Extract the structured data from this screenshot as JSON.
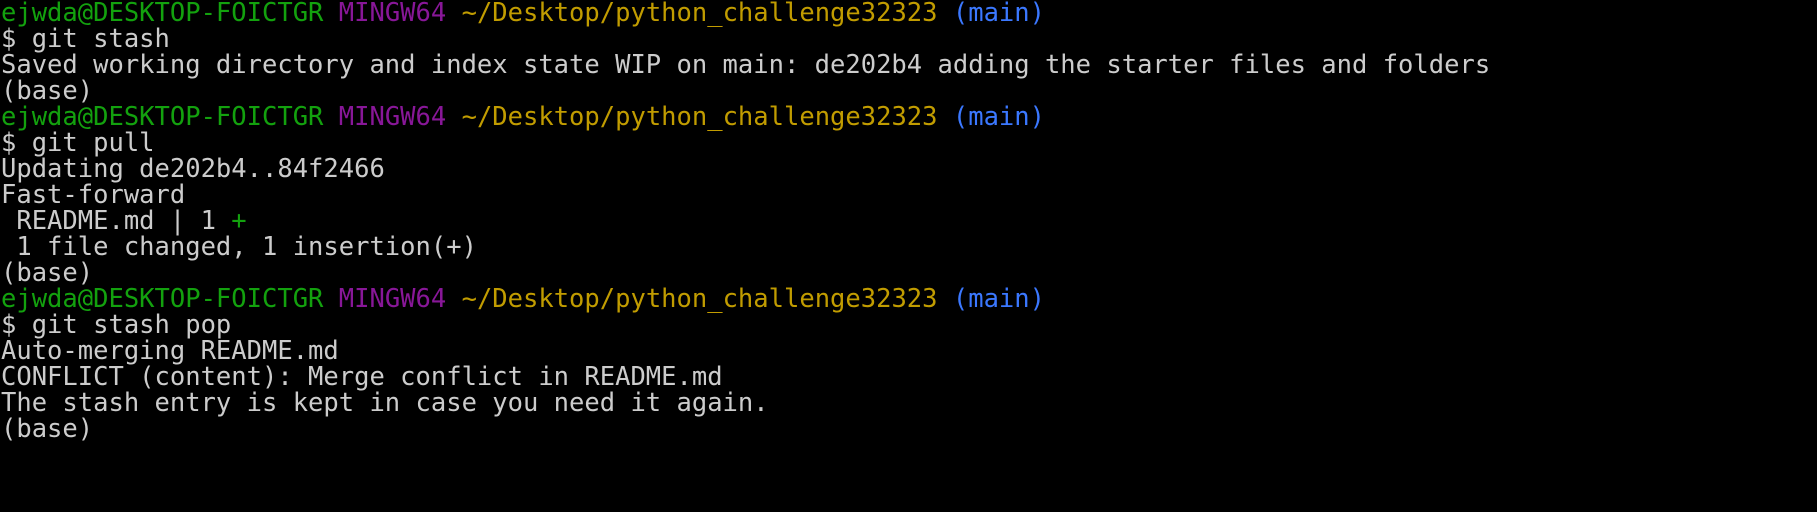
{
  "prompt": {
    "user_host": "ejwda@DESKTOP-FOICTGR",
    "shell": "MINGW64",
    "path": "~/Desktop/python_challenge32323",
    "branch": "(main)"
  },
  "colors": {
    "background": "#000000",
    "text": "#cccccc",
    "user_host": "#13a10e",
    "shell": "#881798",
    "path": "#c19c00",
    "branch": "#3b78ff"
  },
  "blocks": {
    "stash": {
      "command": "$ git stash",
      "output": [
        "Saved working directory and index state WIP on main: de202b4 adding the starter files and folders"
      ],
      "env": "(base)"
    },
    "pull": {
      "command": "$ git pull",
      "output": [
        "Updating de202b4..84f2466",
        "Fast-forward"
      ],
      "diffstat_file": " README.md | 1 ",
      "diffstat_plus": "+",
      "summary": " 1 file changed, 1 insertion(+)",
      "env": "(base)"
    },
    "pop": {
      "command": "$ git stash pop",
      "output": [
        "Auto-merging README.md",
        "CONFLICT (content): Merge conflict in README.md",
        "The stash entry is kept in case you need it again."
      ],
      "env": "(base)"
    }
  }
}
